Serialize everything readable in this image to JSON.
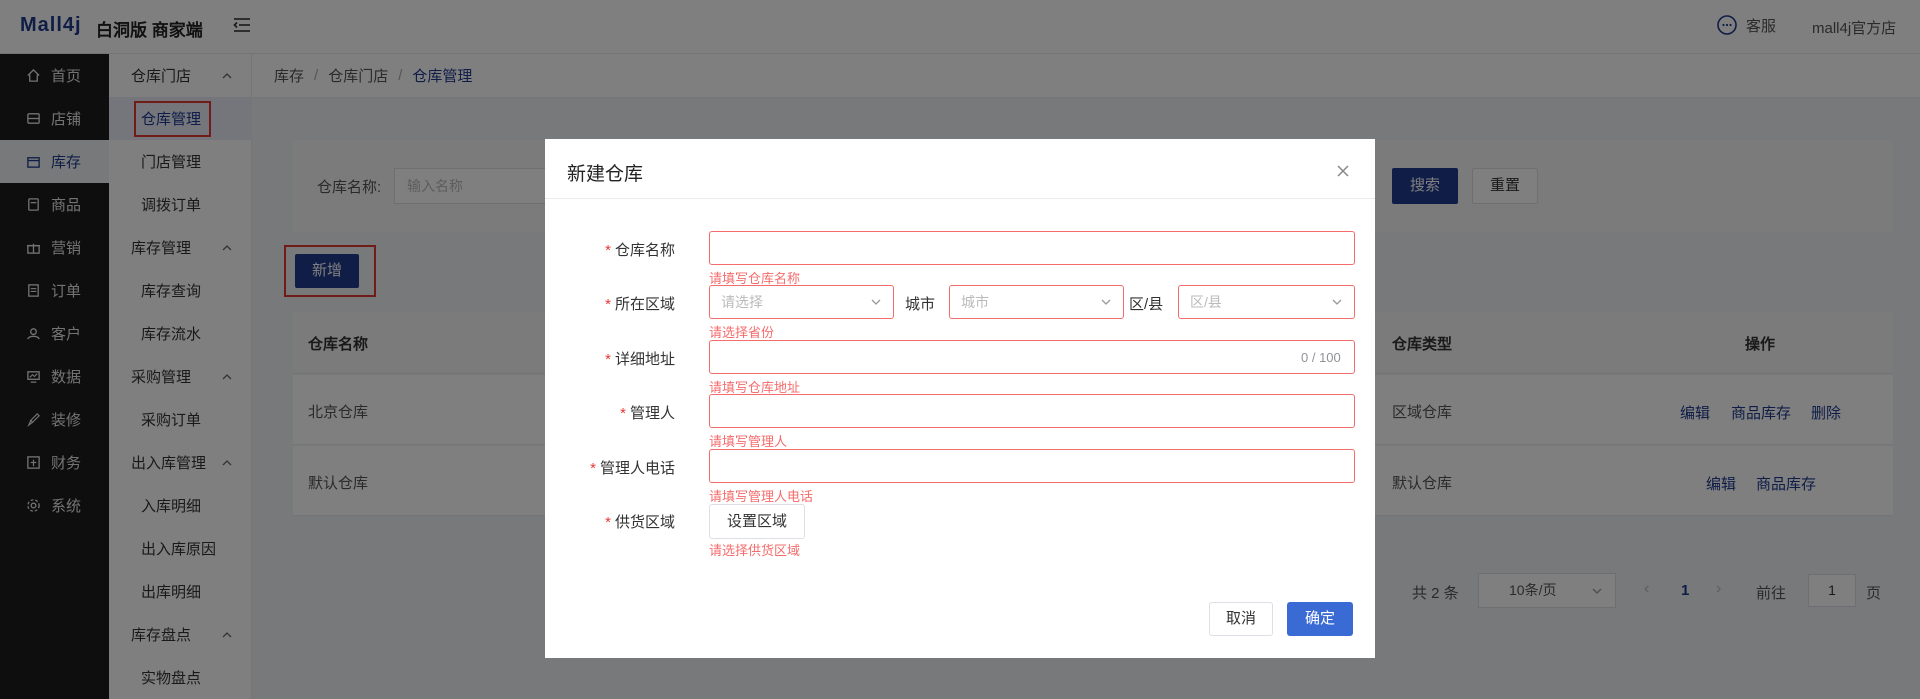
{
  "app": {
    "logo": "Mall4j",
    "subtitle": "白洞版 商家端",
    "service_label": "客服",
    "shop_name": "mall4j官方店"
  },
  "sidebar": {
    "items": [
      {
        "label": "首页",
        "icon": "home-icon"
      },
      {
        "label": "店铺",
        "icon": "store-icon"
      },
      {
        "label": "库存",
        "icon": "box-icon",
        "active": true
      },
      {
        "label": "商品",
        "icon": "product-icon"
      },
      {
        "label": "营销",
        "icon": "gift-icon"
      },
      {
        "label": "订单",
        "icon": "order-icon"
      },
      {
        "label": "客户",
        "icon": "user-icon"
      },
      {
        "label": "数据",
        "icon": "chart-icon"
      },
      {
        "label": "装修",
        "icon": "brush-icon"
      },
      {
        "label": "财务",
        "icon": "finance-icon"
      },
      {
        "label": "系统",
        "icon": "settings-icon"
      }
    ]
  },
  "subbar": {
    "groups": [
      {
        "label": "仓库门店",
        "items": [
          "仓库管理",
          "门店管理",
          "调拨订单"
        ]
      },
      {
        "label": "库存管理",
        "items": [
          "库存查询",
          "库存流水"
        ]
      },
      {
        "label": "采购管理",
        "items": [
          "采购订单"
        ]
      },
      {
        "label": "出入库管理",
        "items": [
          "入库明细",
          "出入库原因",
          "出库明细"
        ]
      },
      {
        "label": "库存盘点",
        "items": [
          "实物盘点"
        ]
      }
    ]
  },
  "breadcrumb": {
    "level1": "库存",
    "level2": "仓库门店",
    "current": "仓库管理",
    "sep": "/"
  },
  "search": {
    "label": "仓库名称:",
    "placeholder": "输入名称",
    "search_button": "搜索",
    "reset_button": "重置"
  },
  "add_button": "新增",
  "table": {
    "headers": {
      "name": "仓库名称",
      "type": "仓库类型",
      "actions": "操作"
    },
    "rows": [
      {
        "name": "北京仓库",
        "type": "区域仓库",
        "actions": [
          "编辑",
          "商品库存",
          "删除"
        ]
      },
      {
        "name": "默认仓库",
        "type": "默认仓库",
        "actions": [
          "编辑",
          "商品库存"
        ]
      }
    ]
  },
  "pagination": {
    "total": "共 2 条",
    "page_size": "10条/页",
    "current_page": "1",
    "goto_label": "前往",
    "goto_value": "1",
    "page_suffix": "页",
    "prev": "‹",
    "next": "›"
  },
  "dialog": {
    "title": "新建仓库",
    "fields": {
      "name": {
        "label": "仓库名称",
        "error": "请填写仓库名称"
      },
      "region": {
        "label": "所在区域",
        "province_placeholder": "请选择",
        "city_label": "城市",
        "city_placeholder": "城市",
        "district_label": "区/县",
        "district_placeholder": "区/县",
        "error": "请选择省份"
      },
      "address": {
        "label": "详细地址",
        "counter": "0 / 100",
        "error": "请填写仓库地址"
      },
      "manager": {
        "label": "管理人",
        "error": "请填写管理人"
      },
      "phone": {
        "label": "管理人电话",
        "error": "请填写管理人电话"
      },
      "supply": {
        "label": "供货区域",
        "button": "设置区域",
        "error": "请选择供货区域"
      }
    },
    "required_mark": "*",
    "cancel": "取消",
    "confirm": "确定"
  },
  "colors": {
    "brand": "#1f3b8f",
    "primary_button": "#3a6bd4",
    "error": "#f56c6c",
    "highlight_frame": "#e53935"
  }
}
